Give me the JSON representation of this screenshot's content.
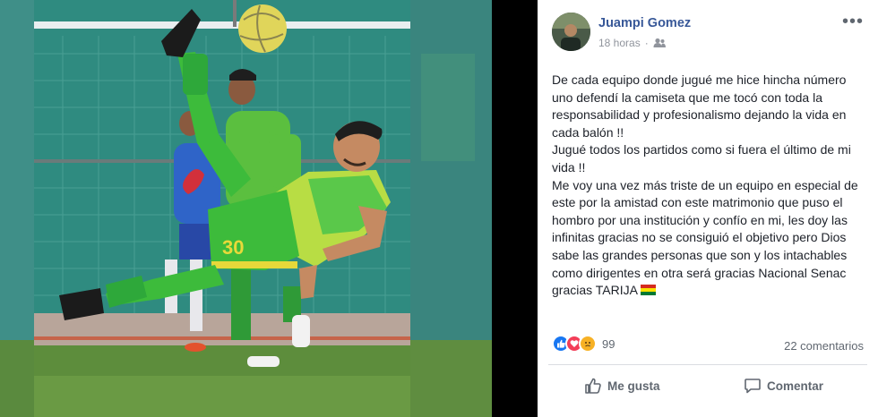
{
  "post": {
    "author": "Juampi Gomez",
    "time": "18 horas",
    "audience_icon": "friends-icon",
    "paragraphs": [
      "De cada equipo donde jugué me hice hincha número uno defendí la camiseta que me tocó con toda la responsabilidad y profesionalismo dejando la vida en cada balón !!",
      "Jugué todos los partidos como si fuera el último de mi vida !!",
      "Me voy una vez más triste de un equipo en especial de este por la amistad con este matrimonio que puso el hombro por una institución y confío en mi, les doy las infinitas gracias no se consiguió el objetivo pero Dios sabe las grandes personas que son y los intachables como dirigentes en otra será gracias Nacional Senac gracias TARIJA"
    ],
    "flag_icon": "bolivia-flag-icon"
  },
  "reactions": {
    "icons": [
      "like-icon",
      "love-icon",
      "sad-icon"
    ],
    "count": "99",
    "comments": "22 comentarios"
  },
  "actions": {
    "like": "Me gusta",
    "comment": "Comentar"
  },
  "photo": {
    "jersey_number": "30"
  },
  "colors": {
    "link": "#385898",
    "like": "#1877f2",
    "love": "#f33e58",
    "sad": "#f7b125"
  }
}
